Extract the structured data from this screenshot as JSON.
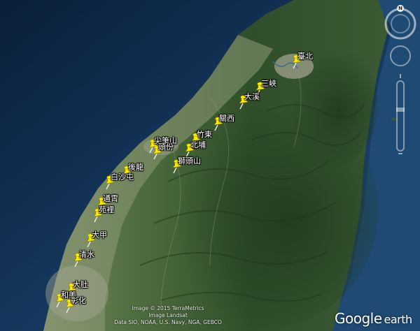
{
  "pins": [
    {
      "id": "taipei",
      "label": "臺北"
    },
    {
      "id": "sanxia",
      "label": "三峽"
    },
    {
      "id": "daxi",
      "label": "大溪"
    },
    {
      "id": "guanxi",
      "label": "關西"
    },
    {
      "id": "zhudong",
      "label": "竹東"
    },
    {
      "id": "beipu",
      "label": "北埔"
    },
    {
      "id": "shitoushan",
      "label": "獅頭山"
    },
    {
      "id": "jianbishan",
      "label": "尖筆山"
    },
    {
      "id": "toufen",
      "label": "頭份"
    },
    {
      "id": "houlong",
      "label": "後龍"
    },
    {
      "id": "baishatun",
      "label": "白沙屯"
    },
    {
      "id": "tongxiao",
      "label": "通霄"
    },
    {
      "id": "yuanli",
      "label": "苑裡"
    },
    {
      "id": "dajia",
      "label": "大甲"
    },
    {
      "id": "qingshui",
      "label": "清水"
    },
    {
      "id": "dadu",
      "label": "大肚"
    },
    {
      "id": "hemei",
      "label": "和美"
    },
    {
      "id": "changhua",
      "label": "彰化"
    }
  ],
  "credits": {
    "line1": "Image © 2015 TerraMetrics",
    "line2": "Image Landsat",
    "line3": "Data SIO, NOAA, U.S. Navy, NGA, GEBCO"
  },
  "brand": {
    "google": "Google",
    "earth": "earth"
  },
  "navigation": {
    "north_label": "N"
  },
  "colors": {
    "pin": "#ffee00",
    "ocean": "#14365c",
    "land": "#3f5c33"
  }
}
